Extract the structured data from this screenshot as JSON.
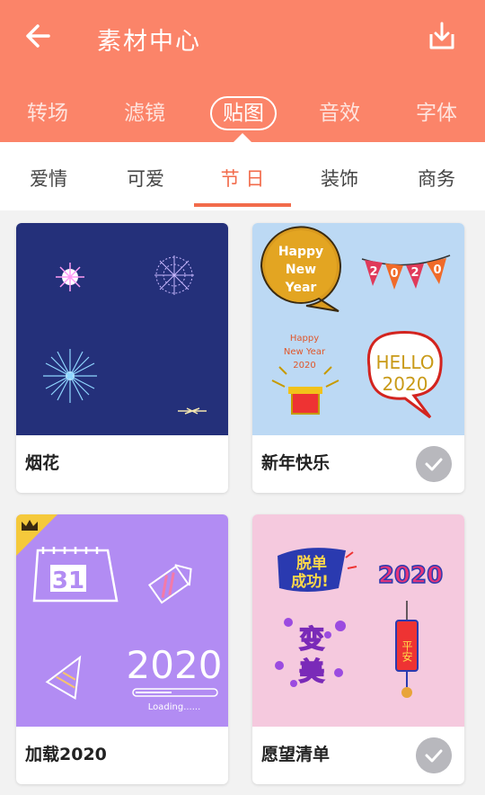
{
  "header": {
    "title": "素材中心",
    "tabs": [
      {
        "label": "转场",
        "active": false
      },
      {
        "label": "滤镜",
        "active": false
      },
      {
        "label": "贴图",
        "active": true
      },
      {
        "label": "音效",
        "active": false
      },
      {
        "label": "字体",
        "active": false
      }
    ]
  },
  "subtabs": [
    {
      "label": "爱情",
      "active": false
    },
    {
      "label": "可爱",
      "active": false
    },
    {
      "label": "节 日",
      "active": true
    },
    {
      "label": "装饰",
      "active": false
    },
    {
      "label": "商务",
      "active": false
    }
  ],
  "cards": [
    {
      "label": "烟花",
      "downloaded": false
    },
    {
      "label": "新年快乐",
      "downloaded": true,
      "art": {
        "bubble": [
          "Happy",
          "New",
          "Year"
        ],
        "flags": [
          "2",
          "0",
          "2",
          "0"
        ],
        "card_text": [
          "Happy",
          "New Year",
          "2020"
        ],
        "hello": [
          "HELLO",
          "2020"
        ]
      }
    },
    {
      "label": "加载2020",
      "downloaded": false,
      "premium": true,
      "art": {
        "calendar_day": "31",
        "year": "2020",
        "loading": "Loading......"
      }
    },
    {
      "label": "愿望清单",
      "downloaded": true,
      "art": {
        "sticker1": [
          "脱单",
          "成功!"
        ],
        "sticker2": "2020",
        "sticker3": [
          "变",
          "美"
        ],
        "sticker4": "平安"
      }
    }
  ],
  "colors": {
    "header": "#fb8469",
    "accent": "#f26b4b"
  }
}
